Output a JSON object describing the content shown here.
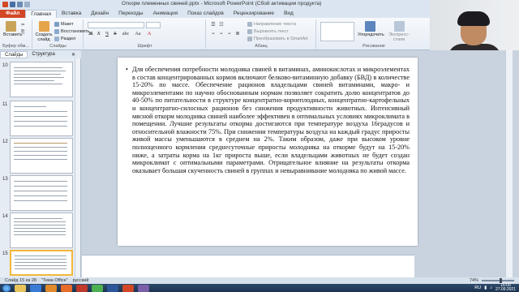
{
  "window": {
    "title": "Откорм племенных свиней.pptx - Microsoft PowerPoint (Сбой активации продукта)",
    "min": "–",
    "max": "□",
    "close": "✕"
  },
  "tabs": [
    "Файл",
    "Главная",
    "Вставка",
    "Дизайн",
    "Переходы",
    "Анимация",
    "Показ слайдов",
    "Рецензирование",
    "Вид"
  ],
  "ribbon": {
    "paste": "Вставить",
    "create_slide": "Создать слайд",
    "layout": "Макет",
    "reset": "Восстановить",
    "section": "Раздел",
    "text_direction": "Направление текста",
    "align_text": "Выровнять текст",
    "smartart": "Преобразовать в SmartArt",
    "arrange": "Упорядочить",
    "quick_styles": "Экспресс-стили",
    "groups": {
      "clipboard": "Буфер обм...",
      "slides": "Слайды",
      "font": "Шрифт",
      "paragraph": "Абзац",
      "drawing": "Рисование"
    },
    "format_bold": "Ж",
    "format_italic": "К",
    "format_underline": "Ч",
    "format_strike": "S",
    "format_abc": "abc",
    "format_aa": "Aa",
    "format_a": "A"
  },
  "side_panel": {
    "tab_slides": "Слайды",
    "tab_outline": "Структура",
    "close": "✕",
    "thumbs": [
      {
        "num": "10"
      },
      {
        "num": "11"
      },
      {
        "num": "12"
      },
      {
        "num": "13"
      },
      {
        "num": "14"
      },
      {
        "num": "15"
      }
    ]
  },
  "slide": {
    "bullet": "•",
    "text": "Для обеспечения потребности молодняка свиней в витаминах, аминокислотах и микроэлементах в состав концентрированных кормов включают белково-витаминную добавку (БВД) в количестве 15-20% по массе. Обеспечение рационов владельцами свиней витаминами, макро- и микроэлементами по научно обоснованным нормам позволяет сократить долю концентратов до 40-50% по питательности в структуре концентратно-корнеплодных, концентратно-картофельных и концентратно-силосных рационов без снижения продуктивности животных. Интенсивный мясной откорм молодняка свиней наиболее эффективен в оптимальных условиях микроклимата в помещении. Лучшие результаты откорма достигаются при температуре воздуха 16градусов и относительной влажности 75%. При снижении температуры воздуха на каждый градус приросты живой массы уменьшаются в среднем на 2%. Таким образом, даже при высоком уровне полноценного кормления среднесуточные приросты молодняка на откорме будут на 15-20% ниже, а затраты корма на 1кг прироста выше, если владельцами животных не будет создан микроклимат с оптимальными параметрами. Отрицательное влияние на результаты откорма оказывает большая скученность свиней в группах и невыравнивание молодняка по живой массе."
  },
  "statusbar": {
    "slide_info": "Слайд 15 из 28",
    "theme": "\"Тема Office\"",
    "language": "русский",
    "zoom": "74%"
  },
  "taskbar": {
    "lang": "RU",
    "time": "16:09",
    "date": "27.09.2021"
  },
  "colors": {
    "file_tab": "#d24726",
    "selected_thumb": "#f3b63a",
    "taskbar": "#1c3350"
  }
}
